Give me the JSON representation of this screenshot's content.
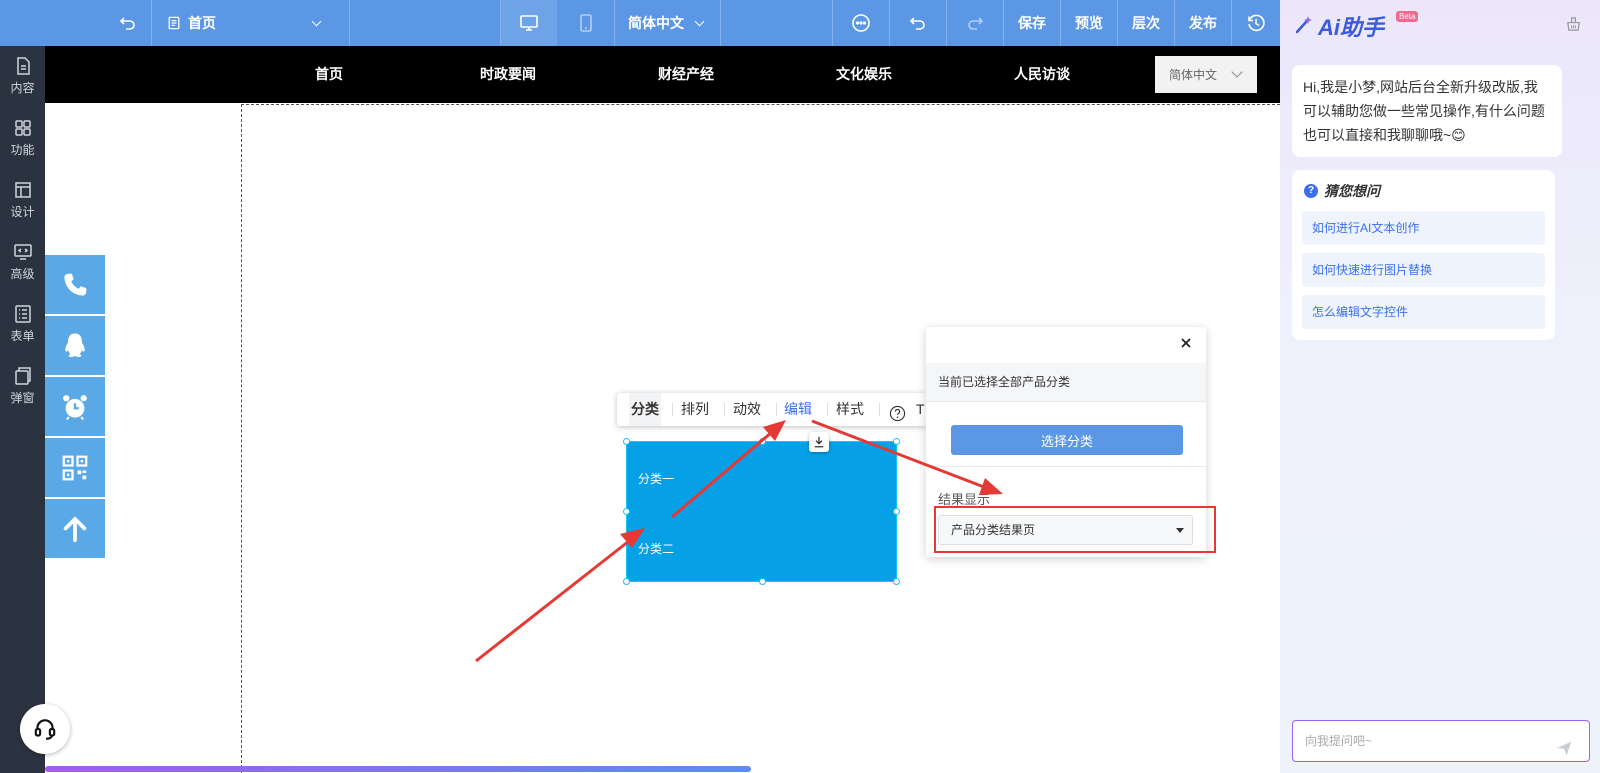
{
  "topbar": {
    "page_label": "首页",
    "language": "简体中文",
    "save_label": "保存",
    "preview_label": "预览",
    "layers_label": "层次",
    "publish_label": "发布"
  },
  "leftbar": {
    "items": [
      {
        "label": "内容",
        "icon": "document-icon"
      },
      {
        "label": "功能",
        "icon": "grid-icon"
      },
      {
        "label": "设计",
        "icon": "layout-icon"
      },
      {
        "label": "高级",
        "icon": "code-monitor-icon"
      },
      {
        "label": "表单",
        "icon": "form-list-icon"
      },
      {
        "label": "弹窗",
        "icon": "popup-icon"
      }
    ]
  },
  "site_nav": {
    "items": [
      "首页",
      "时政要闻",
      "财经产经",
      "文化娱乐",
      "人民访谈"
    ],
    "language": "简体中文"
  },
  "floating_tools": [
    "phone-icon",
    "qq-icon",
    "alarm-clock-icon",
    "qrcode-icon",
    "arrow-up-icon"
  ],
  "component_toolbar": {
    "items": [
      "分类",
      "排列",
      "动效",
      "编辑",
      "样式"
    ],
    "active": "编辑",
    "partial": "T"
  },
  "component": {
    "categories": [
      "分类一",
      "分类二"
    ],
    "color": "#06a0e6"
  },
  "popup": {
    "hint": "当前已选择全部产品分类",
    "select_button": "选择分类",
    "result_label": "结果显示",
    "result_value": "产品分类结果页"
  },
  "ai_panel": {
    "title": "Ai助手",
    "badge": "Beta",
    "greeting": "Hi,我是小梦,网站后台全新升级改版,我可以辅助您做一些常见操作,有什么问题也可以直接和我聊聊哦~😊",
    "guess_title": "猜您想问",
    "suggestions": [
      "如何进行AI文本创作",
      "如何快速进行图片替换",
      "怎么编辑文字控件"
    ],
    "input_placeholder": "向我提问吧~"
  },
  "progress": {
    "fraction": 0.746
  },
  "colors": {
    "primary": "#5b97e5",
    "accent_red": "#e53935",
    "ai_blue": "#3b6ff0"
  }
}
